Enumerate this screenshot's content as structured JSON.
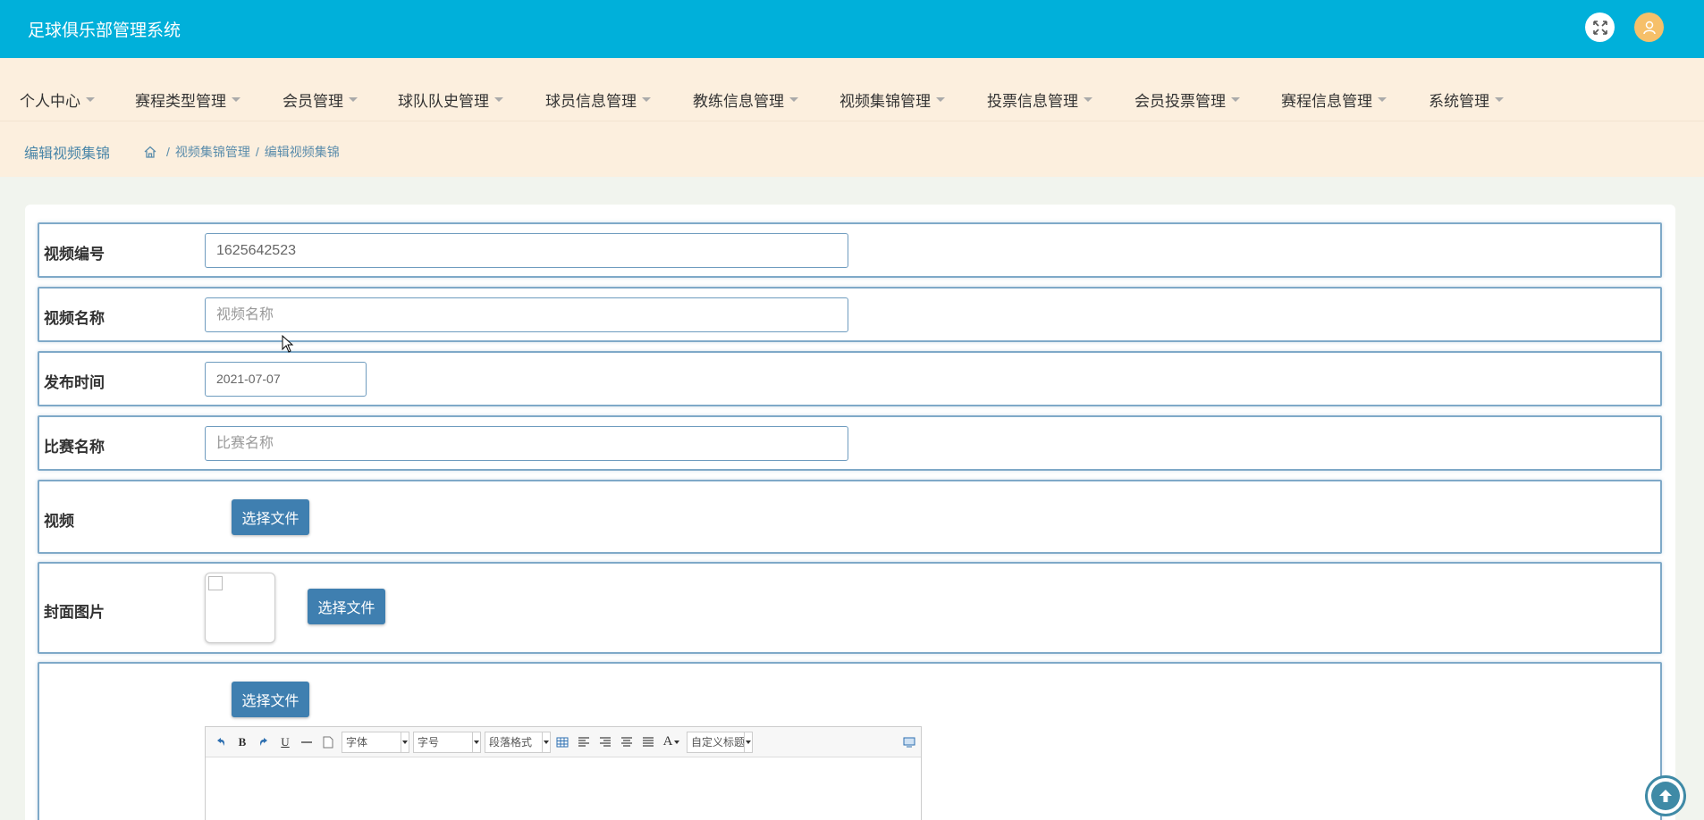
{
  "app": {
    "title": "足球俱乐部管理系统"
  },
  "menu": [
    {
      "label": "个人中心"
    },
    {
      "label": "赛程类型管理"
    },
    {
      "label": "会员管理"
    },
    {
      "label": "球队队史管理"
    },
    {
      "label": "球员信息管理"
    },
    {
      "label": "教练信息管理"
    },
    {
      "label": "视频集锦管理"
    },
    {
      "label": "投票信息管理"
    },
    {
      "label": "会员投票管理"
    },
    {
      "label": "赛程信息管理"
    },
    {
      "label": "系统管理"
    }
  ],
  "breadcrumb": {
    "page_title": "编辑视频集锦",
    "separator": "/",
    "items": [
      "视频集锦管理",
      "编辑视频集锦"
    ]
  },
  "form": {
    "video_no": {
      "label": "视频编号",
      "value": "1625642523"
    },
    "video_name": {
      "label": "视频名称",
      "placeholder": "视频名称"
    },
    "publish_time": {
      "label": "发布时间",
      "value": "2021-07-07"
    },
    "match_name": {
      "label": "比赛名称",
      "placeholder": "比赛名称"
    },
    "video": {
      "label": "视频",
      "button": "选择文件"
    },
    "cover": {
      "label": "封面图片",
      "button": "选择文件"
    },
    "content": {
      "label": "",
      "button": "选择文件"
    }
  },
  "editor_toolbar": {
    "font": "字体",
    "size": "字号",
    "paragraph": "段落格式",
    "custom_title": "自定义标题",
    "font_color_glyph": "A"
  },
  "colors": {
    "topbar": "#00b0da",
    "menubar": "#fcefde",
    "button": "#3f7fb0",
    "avatar": "#f6c06a"
  }
}
